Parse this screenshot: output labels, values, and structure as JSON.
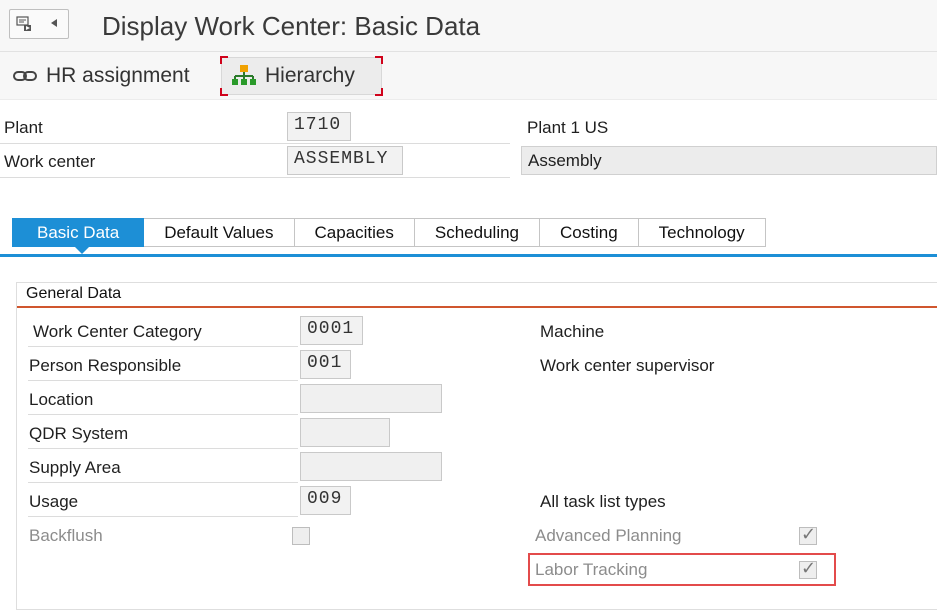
{
  "header": {
    "title": "Display Work Center: Basic Data"
  },
  "toolbar": {
    "hr_assignment_label": "HR assignment",
    "hierarchy_label": "Hierarchy"
  },
  "basic_header": {
    "plant_label": "Plant",
    "plant_value": "1710",
    "plant_desc": "Plant 1 US",
    "workcenter_label": "Work center",
    "workcenter_value": "ASSEMBLY",
    "workcenter_desc": "Assembly"
  },
  "tabs": [
    {
      "label": "Basic Data"
    },
    {
      "label": "Default Values"
    },
    {
      "label": "Capacities"
    },
    {
      "label": "Scheduling"
    },
    {
      "label": "Costing"
    },
    {
      "label": "Technology"
    }
  ],
  "general_data": {
    "title": "General Data",
    "work_center_category_label": "Work Center Category",
    "work_center_category_value": "0001",
    "work_center_category_desc": "Machine",
    "person_responsible_label": "Person Responsible",
    "person_responsible_value": "001",
    "person_responsible_desc": "Work center supervisor",
    "location_label": "Location",
    "location_value": "",
    "qdr_system_label": "QDR System",
    "qdr_system_value": "",
    "supply_area_label": "Supply Area",
    "supply_area_value": "",
    "usage_label": "Usage",
    "usage_value": "009",
    "usage_desc": "All task list types",
    "backflush_label": "Backflush",
    "advanced_planning_label": "Advanced Planning",
    "labor_tracking_label": "Labor Tracking",
    "checkmark_glyph": "✓"
  },
  "colors": {
    "accent": "#1d8fd6",
    "group_rule": "#d0562e",
    "highlight": "#e34b4b"
  }
}
